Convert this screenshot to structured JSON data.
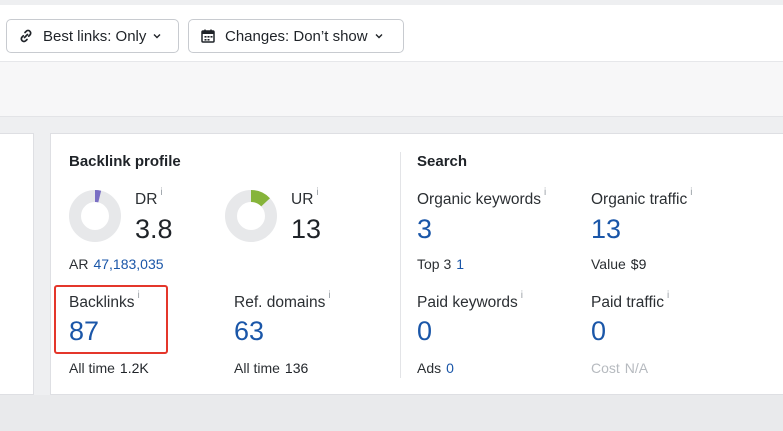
{
  "filters": {
    "best_links": {
      "label": "Best links: Only",
      "icon": "link-icon"
    },
    "changes": {
      "label": "Changes: Don’t show",
      "icon": "calendar-icon"
    }
  },
  "backlink_profile": {
    "title": "Backlink profile",
    "dr": {
      "label": "DR",
      "value": "3.8",
      "gauge_fraction": 0.038,
      "gauge_color": "#7a6fc4"
    },
    "ur": {
      "label": "UR",
      "value": "13",
      "gauge_fraction": 0.13,
      "gauge_color": "#86b43a"
    },
    "ar": {
      "label": "AR",
      "value": "47,183,035"
    },
    "backlinks": {
      "label": "Backlinks",
      "value": "87",
      "sub_label": "All time",
      "sub_value": "1.2K"
    },
    "ref_domains": {
      "label": "Ref. domains",
      "value": "63",
      "sub_label": "All time",
      "sub_value": "136"
    }
  },
  "search": {
    "title": "Search",
    "organic_keywords": {
      "label": "Organic keywords",
      "value": "3",
      "sub_label": "Top 3",
      "sub_value": "1"
    },
    "organic_traffic": {
      "label": "Organic traffic",
      "value": "13",
      "sub_label": "Value",
      "sub_value": "$9"
    },
    "paid_keywords": {
      "label": "Paid keywords",
      "value": "0",
      "sub_label": "Ads",
      "sub_value": "0"
    },
    "paid_traffic": {
      "label": "Paid traffic",
      "value": "0",
      "sub_label": "Cost",
      "sub_value": "N/A"
    }
  },
  "info_marker": "i",
  "colors": {
    "link_blue": "#1a56a8",
    "highlight_red": "#e4362b"
  }
}
